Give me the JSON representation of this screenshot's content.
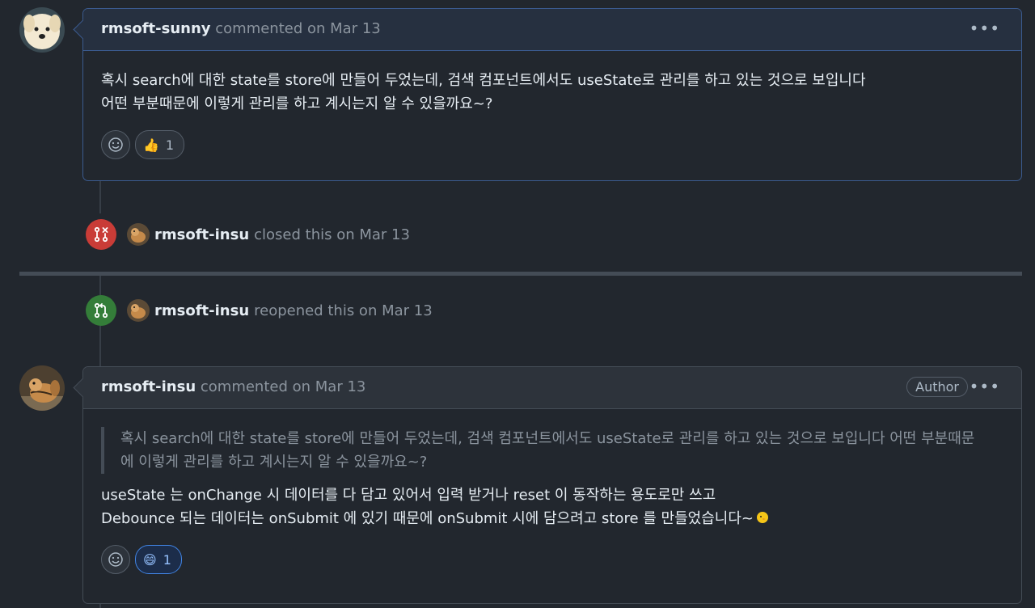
{
  "comments": [
    {
      "author": "rmsoft-sunny",
      "meta": "commented on Mar 13",
      "body_lines": [
        "혹시 search에 대한 state를 store에 만들어 두었는데, 검색 컴포넌트에서도 useState로 관리를 하고 있는 것으로 보입니다",
        "어떤 부분때문에 이렇게 관리를 하고 계시는지 알 수 있을까요~?"
      ],
      "reaction": {
        "emoji": "👍",
        "count": "1"
      },
      "more_icon": "kebab-horizontal-icon"
    },
    {
      "author": "rmsoft-insu",
      "meta": "commented on Mar 13",
      "badge": "Author",
      "quote_lines": [
        "혹시 search에 대한 state를 store에 만들어 두었는데, 검색 컴포넌트에서도 useState로 관리를 하고 있는 것으로 보입니다 어떤 부분때문",
        "에 이렇게 관리를 하고 계시는지 알 수 있을까요~?"
      ],
      "body_lines": [
        "useState 는 onChange 시 데이터를 다 담고 있어서 입력 받거나 reset 이 동작하는 용도로만 쓰고",
        "Debounce 되는 데이터는 onSubmit 에 있기 때문에 onSubmit 시에 담으려고 store 를 만들었습니다~"
      ],
      "reaction": {
        "emoji": "😄",
        "count": "1"
      },
      "more_icon": "kebab-horizontal-icon"
    }
  ],
  "events": [
    {
      "actor": "rmsoft-insu",
      "action": "closed this on Mar 13",
      "icon": "git-pull-request-closed-icon",
      "color": "#c93c37"
    },
    {
      "actor": "rmsoft-insu",
      "action": "reopened this on Mar 13",
      "icon": "git-pull-request-icon",
      "color": "#347d39"
    }
  ],
  "colors": {
    "background": "#22272e",
    "border": "#444c56",
    "highlight_border": "#3b5b8f",
    "text": "#e6edf3",
    "muted": "#8b949e"
  }
}
